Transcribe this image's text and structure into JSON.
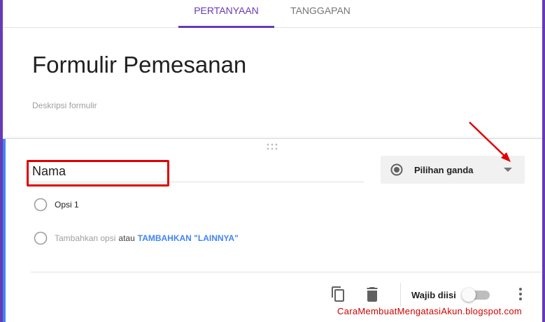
{
  "tabs": [
    {
      "label": "PERTANYAAN",
      "active": true
    },
    {
      "label": "TANGGAPAN",
      "active": false
    }
  ],
  "form": {
    "title": "Formulir Pemesanan",
    "description_placeholder": "Deskripsi formulir"
  },
  "question": {
    "title": "Nama",
    "type": "Pilihan ganda",
    "options": [
      {
        "label": "Opsi 1"
      }
    ],
    "add_option": {
      "label": "Tambahkan opsi",
      "or_text": "atau",
      "other_label": "TAMBAHKAN \"LAINNYA\""
    },
    "required_label": "Wajib diisi",
    "required": false
  },
  "watermark": "CaraMembuatMengatasiAkun.blogspot.com",
  "colors": {
    "accent": "#673ab7",
    "link": "#4285f4",
    "annotation": "#e00000"
  },
  "icons": [
    "drag-handle-icon",
    "radio-button-icon",
    "dropdown-caret-icon",
    "copy-icon",
    "delete-icon",
    "more-vert-icon"
  ]
}
